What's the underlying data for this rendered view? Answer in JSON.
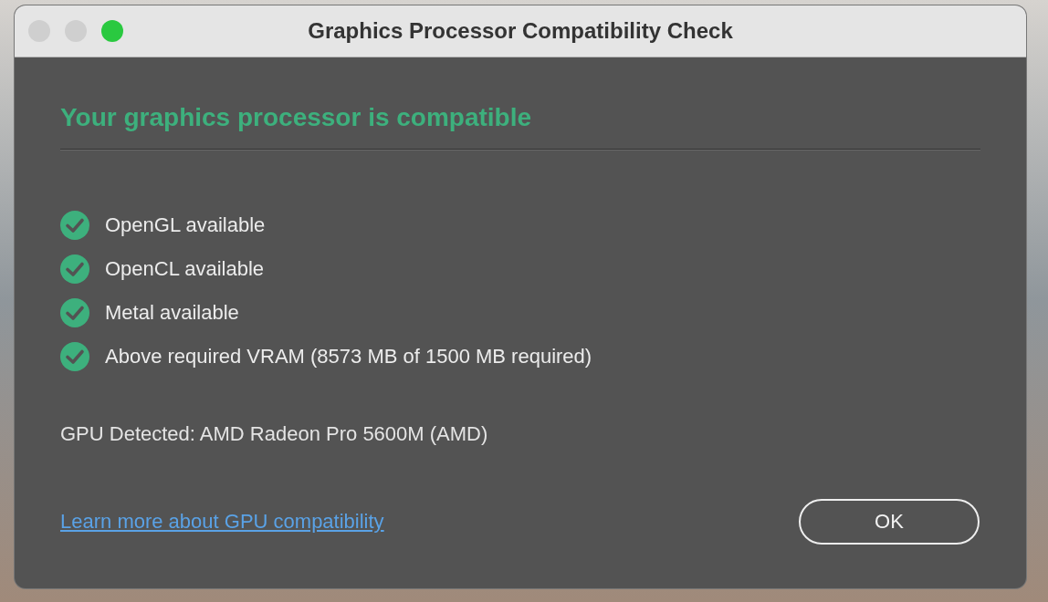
{
  "window": {
    "title": "Graphics Processor Compatibility Check"
  },
  "traffic_lights": [
    {
      "kind": "inactive"
    },
    {
      "kind": "inactive"
    },
    {
      "kind": "zoom"
    }
  ],
  "heading": "Your graphics processor is compatible",
  "checks": [
    {
      "label": "OpenGL available",
      "passed": true
    },
    {
      "label": "OpenCL available",
      "passed": true
    },
    {
      "label": "Metal available",
      "passed": true
    },
    {
      "label": "Above required VRAM (8573 MB of 1500 MB required)",
      "passed": true
    }
  ],
  "gpu_detected": "GPU Detected: AMD Radeon Pro 5600M (AMD)",
  "link": "Learn more about GPU compatibility",
  "buttons": [
    "OK"
  ]
}
